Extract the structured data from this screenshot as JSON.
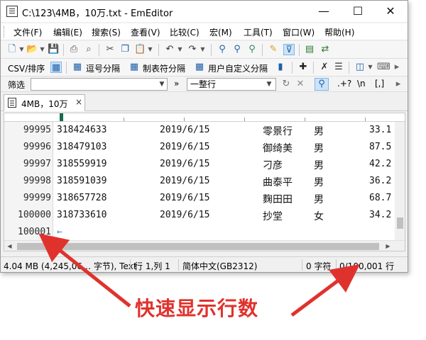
{
  "window": {
    "title": "C:\\123\\4MB，10万.txt - EmEditor",
    "minimize_glyph": "—",
    "maximize_glyph": "☐",
    "close_glyph": "✕"
  },
  "menu": [
    "文件(F)",
    "编辑(E)",
    "搜索(S)",
    "查看(V)",
    "比较(C)",
    "宏(M)",
    "工具(T)",
    "窗口(W)",
    "帮助(H)"
  ],
  "csv_toolbar": {
    "csv_sort": "CSV/排序",
    "comma_separated": "逗号分隔",
    "tab_separated": "制表符分隔",
    "user_defined_separated": "用户自定义分隔"
  },
  "filter_bar": {
    "label": "筛选",
    "filter_value": "",
    "chevron": "»",
    "mode": "一整行",
    "regex_label": ".+?",
    "escape_label": "\\n",
    "brackets_label": "[,]"
  },
  "tab": {
    "label": "4MB，10万",
    "close_glyph": "×"
  },
  "rows": [
    {
      "line": "99995",
      "id": "318424633",
      "date": "2019/6/15",
      "name": "零景行",
      "gender": "男",
      "value": "33.1"
    },
    {
      "line": "99996",
      "id": "318479103",
      "date": "2019/6/15",
      "name": "御绮美",
      "gender": "男",
      "value": "87.5"
    },
    {
      "line": "99997",
      "id": "318559919",
      "date": "2019/6/15",
      "name": "刁彦",
      "gender": "男",
      "value": "42.2"
    },
    {
      "line": "99998",
      "id": "318591039",
      "date": "2019/6/15",
      "name": "曲泰平",
      "gender": "男",
      "value": "36.2"
    },
    {
      "line": "99999",
      "id": "318657728",
      "date": "2019/6/15",
      "name": "麴田田",
      "gender": "男",
      "value": "68.7"
    },
    {
      "line": "100000",
      "id": "318733610",
      "date": "2019/6/15",
      "name": "抄堂",
      "gender": "女",
      "value": "34.2"
    }
  ],
  "last_line": {
    "line": "100001",
    "eof_glyph": "←"
  },
  "status": {
    "file_info": "4.04 MB (4,245,06… 字节), Text",
    "position": "行 1,列 1",
    "encoding": "简体中文(GB2312)",
    "chars": "0 字符",
    "lines": "0/100,001 行"
  },
  "annotation": {
    "text": "快速显示行数",
    "color": "#e0322d"
  },
  "colors": {
    "accent": "#1f5fa8",
    "eof": "#3a86c8",
    "caret": "#1a6b4a"
  }
}
